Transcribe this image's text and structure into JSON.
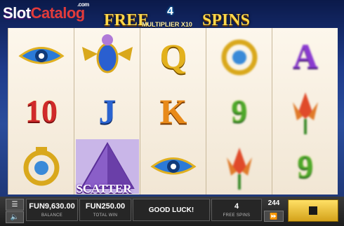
{
  "logo": {
    "part1": "Slot",
    "part2": "Catalog",
    "suffix": ".com"
  },
  "banner": {
    "free": "FREE",
    "count": "4",
    "multiplier": "MULTIPLIER X10",
    "spins": "SPINS"
  },
  "reels": [
    [
      {
        "kind": "icon",
        "name": "eye-of-horus-icon",
        "glyph": "𓂀"
      },
      {
        "kind": "text",
        "text": "10",
        "style": "num-red"
      },
      {
        "kind": "icon",
        "name": "ring-amulet-icon",
        "glyph": "◎"
      }
    ],
    [
      {
        "kind": "icon",
        "name": "scarab-icon",
        "glyph": "🪲"
      },
      {
        "kind": "text",
        "text": "J",
        "style": "j"
      },
      {
        "kind": "icon",
        "name": "pyramid-scatter-icon",
        "glyph": "▲"
      }
    ],
    [
      {
        "kind": "text",
        "text": "Q",
        "style": "q"
      },
      {
        "kind": "text",
        "text": "K",
        "style": "k"
      },
      {
        "kind": "icon",
        "name": "eye-of-horus-icon",
        "glyph": "𓂀"
      }
    ],
    [
      {
        "kind": "icon",
        "name": "ring-amulet-icon",
        "glyph": "◎"
      },
      {
        "kind": "text",
        "text": "9",
        "style": "num-green"
      },
      {
        "kind": "icon",
        "name": "lotus-icon",
        "glyph": "✿"
      }
    ],
    [
      {
        "kind": "text",
        "text": "A",
        "style": "a"
      },
      {
        "kind": "icon",
        "name": "lotus-icon",
        "glyph": "✿"
      },
      {
        "kind": "text",
        "text": "9",
        "style": "num-green"
      }
    ]
  ],
  "scatter_label": "SCATTER",
  "controls": {
    "balance_value": "FUN9,630.00",
    "balance_label": "BALANCE",
    "total_win_value": "FUN250.00",
    "total_win_label": "TOTAL WIN",
    "message": "GOOD LUCK!",
    "free_spins_value": "4",
    "free_spins_label": "FREE SPINS",
    "lines": "244",
    "menu_glyph": "☰",
    "sound_glyph": "🔈",
    "fast_forward_glyph": "⏩"
  },
  "colors": {
    "accent_gold": "#ffd84a",
    "logo_red": "#e23b3b",
    "bar_dark": "#1c1c1c"
  }
}
